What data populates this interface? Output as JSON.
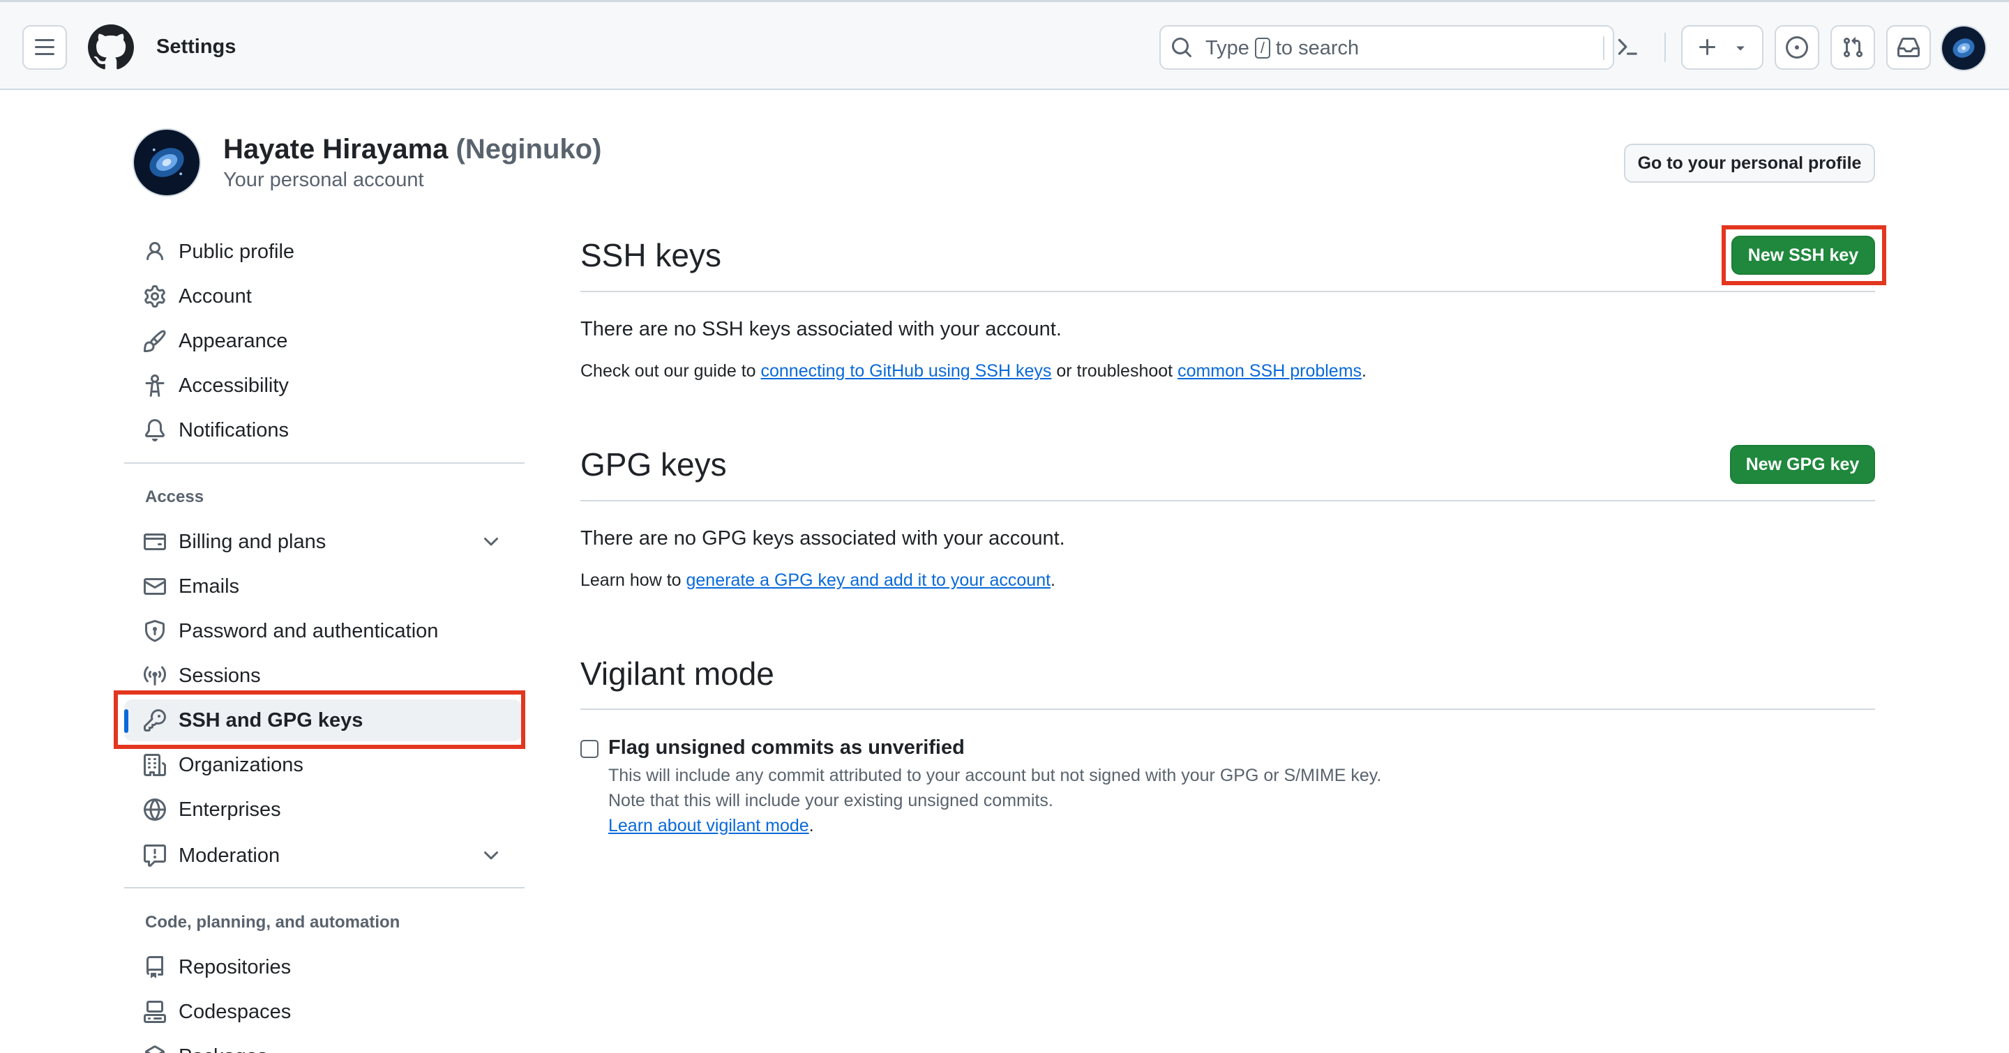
{
  "header": {
    "title": "Settings",
    "search": {
      "before": "Type",
      "key": "/",
      "after": "to search"
    }
  },
  "profile": {
    "name": "Hayate Hirayama",
    "username": "(Neginuko)",
    "subtitle": "Your personal account",
    "goto_label": "Go to your personal profile"
  },
  "sidebar": {
    "top_items": [
      {
        "label": "Public profile",
        "icon": "person-icon"
      },
      {
        "label": "Account",
        "icon": "gear-icon"
      },
      {
        "label": "Appearance",
        "icon": "paintbrush-icon"
      },
      {
        "label": "Accessibility",
        "icon": "accessibility-icon"
      },
      {
        "label": "Notifications",
        "icon": "bell-icon"
      }
    ],
    "access_heading": "Access",
    "access_items": [
      {
        "label": "Billing and plans",
        "icon": "credit-card-icon",
        "expandable": true
      },
      {
        "label": "Emails",
        "icon": "mail-icon"
      },
      {
        "label": "Password and authentication",
        "icon": "shield-lock-icon"
      },
      {
        "label": "Sessions",
        "icon": "broadcast-icon"
      },
      {
        "label": "SSH and GPG keys",
        "icon": "key-icon",
        "selected": true
      },
      {
        "label": "Organizations",
        "icon": "organization-icon"
      },
      {
        "label": "Enterprises",
        "icon": "globe-icon"
      },
      {
        "label": "Moderation",
        "icon": "report-icon",
        "expandable": true
      }
    ],
    "code_heading": "Code, planning, and automation",
    "code_items": [
      {
        "label": "Repositories",
        "icon": "repo-icon"
      },
      {
        "label": "Codespaces",
        "icon": "codespaces-icon"
      },
      {
        "label": "Packages",
        "icon": "package-icon"
      }
    ]
  },
  "ssh": {
    "title": "SSH keys",
    "new_button": "New SSH key",
    "empty": "There are no SSH keys associated with your account.",
    "guide_prefix": "Check out our guide to ",
    "guide_link": "connecting to GitHub using SSH keys",
    "guide_middle": " or troubleshoot ",
    "problems_link": "common SSH problems",
    "guide_suffix": "."
  },
  "gpg": {
    "title": "GPG keys",
    "new_button": "New GPG key",
    "empty": "There are no GPG keys associated with your account.",
    "learn_prefix": "Learn how to ",
    "learn_link": "generate a GPG key and add it to your account",
    "learn_suffix": "."
  },
  "vigilant": {
    "title": "Vigilant mode",
    "checkbox_label": "Flag unsigned commits as unverified",
    "checked": false,
    "note1": "This will include any commit attributed to your account but not signed with your GPG or S/MIME key.",
    "note2": "Note that this will include your existing unsigned commits.",
    "learn_link": "Learn about vigilant mode",
    "learn_suffix": "."
  },
  "colors": {
    "accent": "#0969da",
    "primary_button": "#1f883d",
    "highlight": "#e3361f"
  }
}
